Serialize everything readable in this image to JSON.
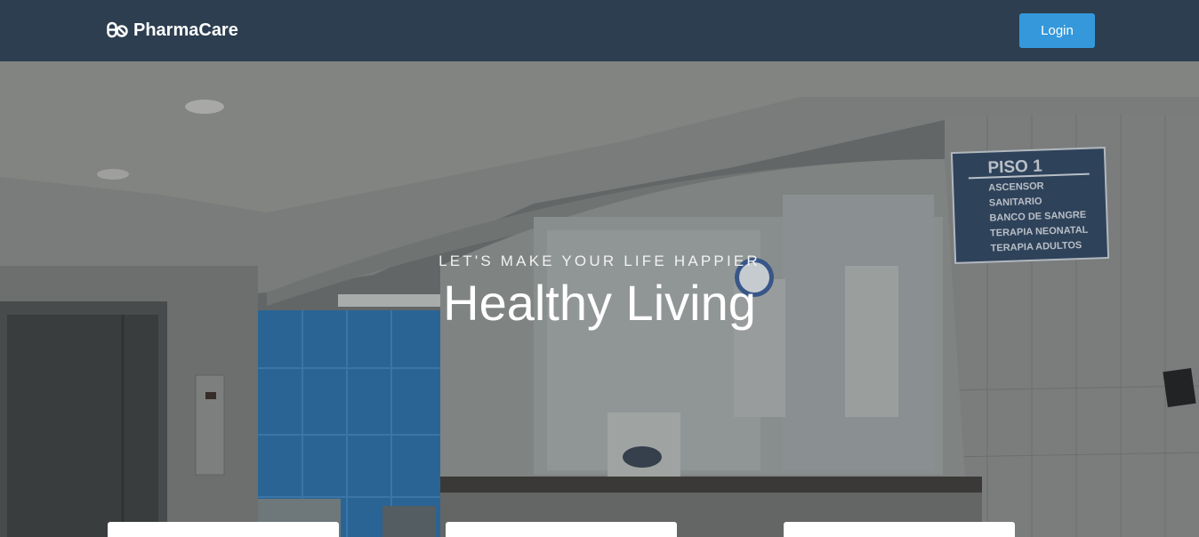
{
  "navbar": {
    "brand_icon": "pills-icon",
    "brand_name": "PharmaCare",
    "login_label": "Login",
    "colors": {
      "bar": "#2c3e50",
      "button": "#3498db"
    }
  },
  "hero": {
    "subtitle": "LET'S MAKE YOUR LIFE HAPPIER",
    "title": "Healthy Living",
    "sign": {
      "heading": "PISO 1",
      "lines": [
        "ASCENSOR",
        "SANITARIO",
        "BANCO DE SANGRE",
        "TERAPIA NEONATAL",
        "TERAPIA ADULTOS"
      ]
    }
  },
  "cards": [
    {
      "name": "feature-card-1"
    },
    {
      "name": "feature-card-2"
    },
    {
      "name": "feature-card-3"
    }
  ]
}
